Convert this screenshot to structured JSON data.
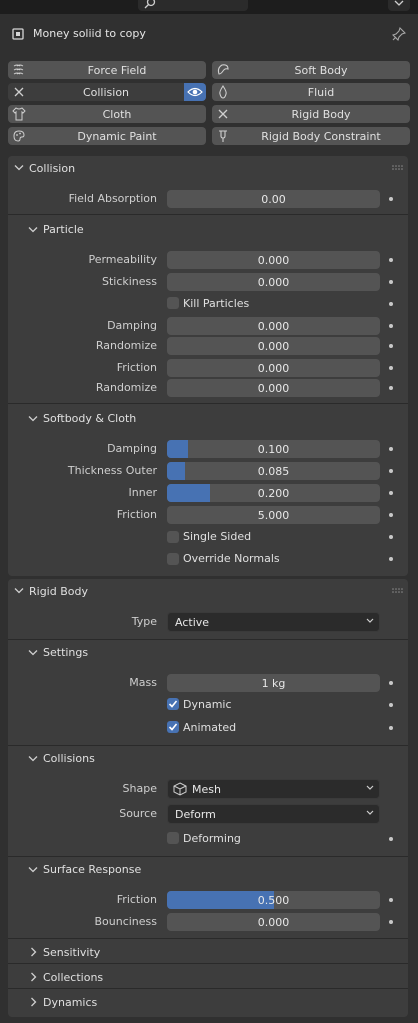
{
  "object_name": "Money soliid to copy",
  "physics_buttons": {
    "force_field": "Force Field",
    "soft_body": "Soft Body",
    "collision": "Collision",
    "fluid": "Fluid",
    "cloth": "Cloth",
    "rigid_body": "Rigid Body",
    "dynamic_paint": "Dynamic Paint",
    "rigid_body_constraint": "Rigid Body Constraint"
  },
  "collision": {
    "title": "Collision",
    "field_absorption_label": "Field Absorption",
    "field_absorption_value": "0.00",
    "particle": {
      "title": "Particle",
      "permeability_label": "Permeability",
      "permeability_value": "0.000",
      "stickiness_label": "Stickiness",
      "stickiness_value": "0.000",
      "kill_particles_label": "Kill Particles",
      "kill_particles_checked": false,
      "damping_label": "Damping",
      "damping_value": "0.000",
      "damping_randomize_label": "Randomize",
      "damping_randomize_value": "0.000",
      "friction_label": "Friction",
      "friction_value": "0.000",
      "friction_randomize_label": "Randomize",
      "friction_randomize_value": "0.000"
    },
    "softbody_cloth": {
      "title": "Softbody & Cloth",
      "damping_label": "Damping",
      "damping_value": "0.100",
      "damping_fraction": 0.1,
      "thickness_outer_label": "Thickness Outer",
      "thickness_outer_value": "0.085",
      "thickness_outer_fraction": 0.085,
      "inner_label": "Inner",
      "inner_value": "0.200",
      "inner_fraction": 0.2,
      "friction_label": "Friction",
      "friction_value": "5.000",
      "single_sided_label": "Single Sided",
      "single_sided_checked": false,
      "override_normals_label": "Override Normals",
      "override_normals_checked": false
    }
  },
  "rigid_body": {
    "title": "Rigid Body",
    "type_label": "Type",
    "type_value": "Active",
    "settings": {
      "title": "Settings",
      "mass_label": "Mass",
      "mass_value": "1 kg",
      "dynamic_label": "Dynamic",
      "dynamic_checked": true,
      "animated_label": "Animated",
      "animated_checked": true
    },
    "collisions": {
      "title": "Collisions",
      "shape_label": "Shape",
      "shape_value": "Mesh",
      "source_label": "Source",
      "source_value": "Deform",
      "deforming_label": "Deforming",
      "deforming_checked": false
    },
    "surface_response": {
      "title": "Surface Response",
      "friction_label": "Friction",
      "friction_value": "0.500",
      "friction_fraction": 0.5,
      "bounciness_label": "Bounciness",
      "bounciness_value": "0.000"
    },
    "sensitivity_title": "Sensitivity",
    "collections_title": "Collections",
    "dynamics_title": "Dynamics"
  },
  "colors": {
    "accent": "#4772b3",
    "panel": "#3d3d3d",
    "field": "#545454"
  },
  "icons": [
    "search-icon",
    "chevron-down-icon",
    "object-icon",
    "pin-icon",
    "force-field-icon",
    "soft-body-icon",
    "collision-icon",
    "eye-icon",
    "fluid-icon",
    "cloth-icon",
    "rigid-body-icon",
    "dynamic-paint-icon",
    "rigid-body-constraint-icon",
    "mesh-icon",
    "checkmark-icon",
    "grip-icon"
  ]
}
